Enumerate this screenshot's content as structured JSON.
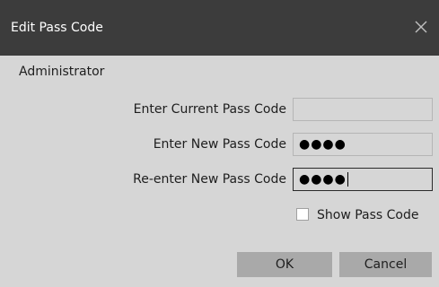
{
  "dialog": {
    "title": "Edit Pass Code",
    "close_icon": "close-icon"
  },
  "section": {
    "label": "Administrator"
  },
  "fields": {
    "current": {
      "label": "Enter Current Pass Code",
      "value": ""
    },
    "new": {
      "label": "Enter New Pass Code",
      "value": "●●●●"
    },
    "reenter": {
      "label": "Re-enter New Pass Code",
      "value": "●●●●"
    }
  },
  "show_pass_code": {
    "label": "Show Pass Code",
    "checked": false
  },
  "buttons": {
    "ok": "OK",
    "cancel": "Cancel"
  },
  "colors": {
    "titlebar": "#3c3c3c",
    "body": "#d6d6d6",
    "button": "#a9a9a9"
  }
}
